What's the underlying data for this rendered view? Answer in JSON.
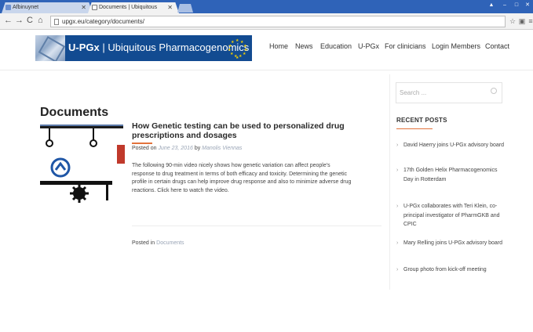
{
  "browser": {
    "tabs": [
      {
        "label": "Afbinuynet",
        "active": false
      },
      {
        "label": "Documents | Ubiquitous",
        "active": true
      }
    ],
    "url": "upgx.eu/category/documents/"
  },
  "site": {
    "logo_brand": "U-PGx",
    "logo_separator": "|",
    "logo_name": "Ubiquitous Pharmacogenomics",
    "nav": [
      "Home",
      "News",
      "Education",
      "U-PGx",
      "For clinicians",
      "Login Members",
      "Contact"
    ]
  },
  "main": {
    "page_title": "Documents",
    "post": {
      "title": "How Genetic testing can be used to personalized drug prescriptions and dosages",
      "posted_on_label": "Posted on",
      "date": "June 23, 2016",
      "by_label": "by",
      "author": "Manolis Viennas",
      "excerpt": "The following 90-min video nicely shows how genetic variation can affect people's response to drug treatment in terms of both efficacy and toxicity. Determining the genetic profile in certain drugs can help improve drug response and also to minimize adverse drug reactions. Click here to watch the video.",
      "posted_in_label": "Posted in",
      "category": "Documents"
    }
  },
  "sidebar": {
    "search_placeholder": "Search ...",
    "recent_heading": "RECENT POSTS",
    "recent_posts": [
      "David Haerry joins U-PGx advisory board",
      "17th Golden Helix Pharmacogenomics Day in Rotterdam",
      "U-PGx collaborates with Teri Klein, co-principal investigator of PharmGKB and CPIC",
      "Mary Relling joins U-PGx advisory board",
      "Group photo from kick-off meeting"
    ]
  },
  "colors": {
    "accent": "#e2733c",
    "logo_bg": "#124b91",
    "tabstrip": "#2f63b8"
  }
}
